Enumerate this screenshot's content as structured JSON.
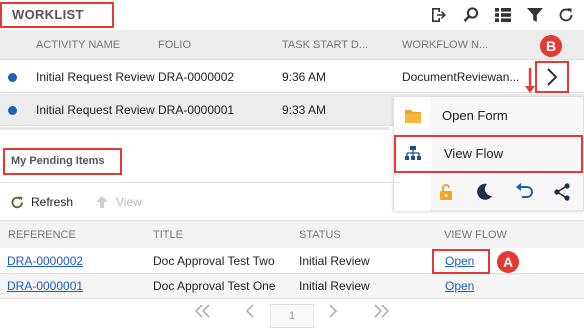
{
  "worklist": {
    "title": "WORKLIST",
    "toolbar_icons": [
      "sign-out-icon",
      "search-icon",
      "list-icon",
      "filter-icon",
      "refresh-icon"
    ],
    "columns": [
      "ACTIVITY NAME",
      "FOLIO",
      "TASK START D...",
      "WORKFLOW N..."
    ],
    "rows": [
      {
        "activity": "Initial Request Review",
        "folio": "DRA-0000002",
        "start": "9:36 AM",
        "workflow": "DocumentReviewan..."
      },
      {
        "activity": "Initial Request Review",
        "folio": "DRA-0000001",
        "start": "9:33 AM",
        "workflow": ""
      }
    ],
    "status_color": "#1d5fbf"
  },
  "popup": {
    "items": [
      {
        "label": "Open Form",
        "icon": "folder-icon"
      },
      {
        "label": "View Flow",
        "icon": "flow-chart-icon"
      }
    ],
    "actions": [
      "unlock-icon",
      "moon-icon",
      "undo-icon",
      "share-icon"
    ]
  },
  "pending": {
    "title": "My Pending Items",
    "toolbar": {
      "refresh": "Refresh",
      "view": "View"
    },
    "columns": [
      "REFERENCE",
      "TITLE",
      "STATUS",
      "VIEW FLOW"
    ],
    "rows": [
      {
        "reference": "DRA-0000002",
        "title": "Doc Approval Test Two",
        "status": "Initial Review",
        "view_flow": "Open"
      },
      {
        "reference": "DRA-0000001",
        "title": "Doc Approval Test One",
        "status": "Initial Review",
        "view_flow": "Open"
      }
    ]
  },
  "pager": {
    "page": "1"
  },
  "callouts": {
    "a": "A",
    "b": "B"
  },
  "colors": {
    "highlight": "#e53935",
    "link": "#1a5cc8"
  }
}
